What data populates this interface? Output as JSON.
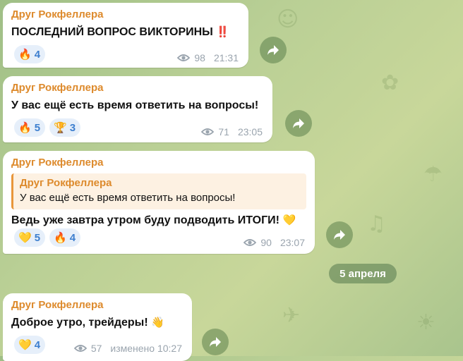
{
  "messages": [
    {
      "sender": "Друг Рокфеллера",
      "text": "ПОСЛЕДНИЙ ВОПРОС ВИКТОРИНЫ",
      "text_emoji": "‼️",
      "reactions": [
        {
          "emoji": "🔥",
          "count": "4"
        }
      ],
      "views": "98",
      "time": "21:31"
    },
    {
      "sender": "Друг Рокфеллера",
      "text": "У вас ещё есть время ответить на вопросы!",
      "reactions": [
        {
          "emoji": "🔥",
          "count": "5"
        },
        {
          "emoji": "🏆",
          "count": "3"
        }
      ],
      "views": "71",
      "time": "23:05"
    },
    {
      "sender": "Друг Рокфеллера",
      "quote": {
        "sender": "Друг Рокфеллера",
        "text": "У вас ещё есть время ответить на вопросы!"
      },
      "text": "Ведь уже завтра утром буду подводить ИТОГИ!",
      "text_emoji": "💛",
      "reactions": [
        {
          "emoji": "💛",
          "count": "5"
        },
        {
          "emoji": "🔥",
          "count": "4"
        }
      ],
      "views": "90",
      "time": "23:07"
    },
    {
      "sender": "Друг Рокфеллера",
      "text": "Доброе утро, трейдеры!",
      "text_emoji": "👋",
      "reactions": [
        {
          "emoji": "💛",
          "count": "4"
        }
      ],
      "views": "57",
      "time": "изменено 10:27"
    }
  ],
  "date_separator": "5 апреля",
  "colors": {
    "accent": "#dd8a2c",
    "reaction_text": "#3d7fcf",
    "reaction_bg": "#e6effa"
  },
  "icons": {
    "views": "eye-icon",
    "forward": "forward-arrow-icon"
  }
}
